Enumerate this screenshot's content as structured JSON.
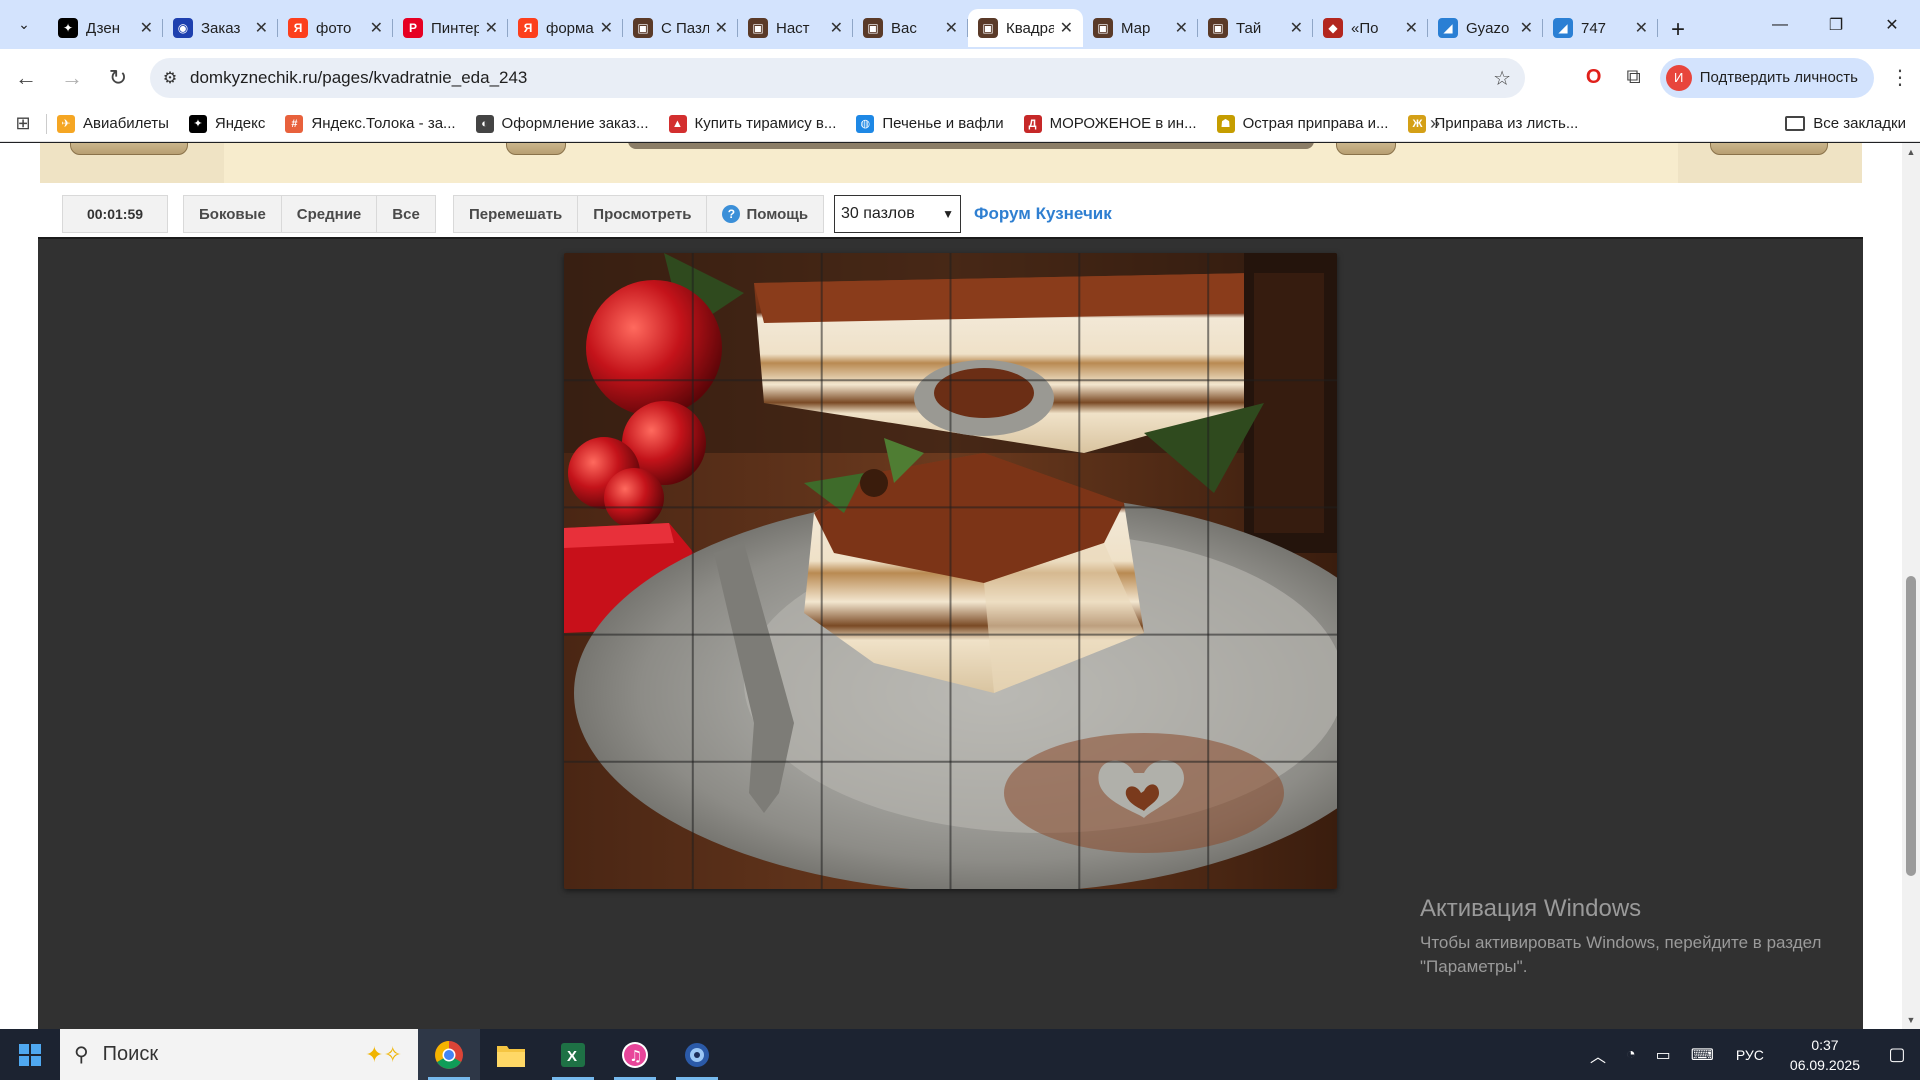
{
  "tabs": [
    {
      "title": "Дзен",
      "icon": "dzen-icon",
      "color": "#000000",
      "glyph": "✦"
    },
    {
      "title": "Заказ",
      "icon": "pepsi-icon",
      "color": "#1e40af",
      "glyph": "◉"
    },
    {
      "title": "фото",
      "icon": "yandex-icon",
      "color": "#fc3f1d",
      "glyph": "Я"
    },
    {
      "title": "Пинтерест",
      "icon": "pinterest-icon",
      "color": "#e60023",
      "glyph": "P"
    },
    {
      "title": "форма",
      "icon": "yandex-icon",
      "color": "#fc3f1d",
      "glyph": "Я"
    },
    {
      "title": "С Пазлы",
      "icon": "puzzle-site-icon",
      "color": "#5a3a28",
      "glyph": "▣"
    },
    {
      "title": "Наст",
      "icon": "puzzle-site-icon",
      "color": "#5a3a28",
      "glyph": "▣"
    },
    {
      "title": "Вас",
      "icon": "puzzle-site-icon",
      "color": "#5a3a28",
      "glyph": "▣"
    },
    {
      "title": "Квадратные",
      "icon": "puzzle-site-icon",
      "color": "#5a3a28",
      "glyph": "▣",
      "active": true
    },
    {
      "title": "Мар",
      "icon": "puzzle-site-icon",
      "color": "#5a3a28",
      "glyph": "▣"
    },
    {
      "title": "Тай",
      "icon": "puzzle-site-icon",
      "color": "#5a3a28",
      "glyph": "▣"
    },
    {
      "title": "«По",
      "icon": "tiramisu-icon",
      "color": "#b3261e",
      "glyph": "◆"
    },
    {
      "title": "Gyazo",
      "icon": "gyazo-icon",
      "color": "#2a7fd4",
      "glyph": "◢"
    },
    {
      "title": "747",
      "icon": "gyazo-icon",
      "color": "#2a7fd4",
      "glyph": "◢"
    }
  ],
  "toolbar": {
    "url": "domkyznechik.ru/pages/kvadratnie_eda_243",
    "profile_label": "Подтвердить личность",
    "profile_initial": "И"
  },
  "bookmarks": [
    {
      "label": "Авиабилеты",
      "color": "#f5a623",
      "glyph": "✈"
    },
    {
      "label": "Яндекс",
      "color": "#000000",
      "glyph": "✦"
    },
    {
      "label": "Яндекс.Толока - за...",
      "color": "#e8613c",
      "glyph": "#"
    },
    {
      "label": "Оформление заказ...",
      "color": "#444444",
      "glyph": "◐"
    },
    {
      "label": "Купить тирамису в...",
      "color": "#d32f2f",
      "glyph": "▲"
    },
    {
      "label": "Печенье и вафли",
      "color": "#1e88e5",
      "glyph": "◍"
    },
    {
      "label": "МОРОЖЕНОЕ в ин...",
      "color": "#c62828",
      "glyph": "Д"
    },
    {
      "label": "Острая приправа и...",
      "color": "#c59d00",
      "glyph": "☗"
    },
    {
      "label": "Приправа из листь...",
      "color": "#d4a017",
      "glyph": "Ж"
    }
  ],
  "all_bookmarks_label": "Все закладки",
  "controls": {
    "timer": "00:01:59",
    "filter_buttons": [
      "Боковые",
      "Средние",
      "Все"
    ],
    "action_buttons": [
      "Перемешать",
      "Просмотреть",
      "Помощь"
    ],
    "pieces_select": "30 пазлов",
    "forum_link": "Форум Кузнечик"
  },
  "puzzle": {
    "columns": 6,
    "rows": 5
  },
  "watermark": {
    "title": "Активация Windows",
    "line1": "Чтобы активировать Windows, перейдите в раздел",
    "line2": "\"Параметры\"."
  },
  "taskbar": {
    "search_placeholder": "Поиск",
    "lang": "РУС",
    "time": "0:37",
    "date": "06.09.2025"
  }
}
